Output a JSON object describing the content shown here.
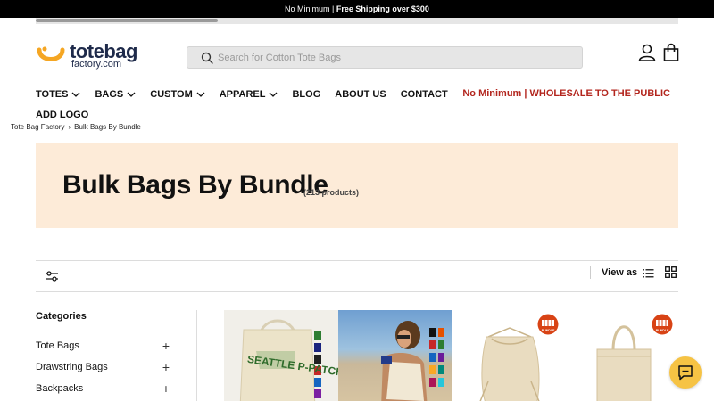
{
  "announcement": {
    "part1": "No Minimum |",
    "part2": "Free Shipping over $300"
  },
  "logo": {
    "word": "totebag",
    "sub": "factory.com"
  },
  "search": {
    "placeholder": "Search for Cotton Tote Bags"
  },
  "nav": {
    "items": [
      {
        "label": "TOTES",
        "dropdown": true
      },
      {
        "label": "BAGS",
        "dropdown": true
      },
      {
        "label": "CUSTOM",
        "dropdown": true
      },
      {
        "label": "APPAREL",
        "dropdown": true
      },
      {
        "label": "BLOG",
        "dropdown": false
      },
      {
        "label": "ABOUT US",
        "dropdown": false
      },
      {
        "label": "CONTACT",
        "dropdown": false
      }
    ],
    "second_row": "ADD LOGO",
    "promo": "No Minimum | WHOLESALE TO THE PUBLIC"
  },
  "breadcrumb": {
    "home": "Tote Bag Factory",
    "current": "Bulk Bags By Bundle"
  },
  "hero": {
    "title": "Bulk Bags By Bundle",
    "count": "(213 products)"
  },
  "toolbar": {
    "view_as": "View as"
  },
  "sidebar": {
    "heading": "Categories",
    "categories": [
      "Tote Bags",
      "Drawstring Bags",
      "Backpacks"
    ]
  },
  "products": {
    "badge_text": "BUNDLE",
    "print_text": "SEATTLE P-PATCH"
  },
  "colors": {
    "accent_red": "#b3261e",
    "hero_bg": "#fdebd8",
    "logo_orange": "#f5a623",
    "logo_navy": "#1e2a4a",
    "chat_yellow": "#f6c344"
  }
}
